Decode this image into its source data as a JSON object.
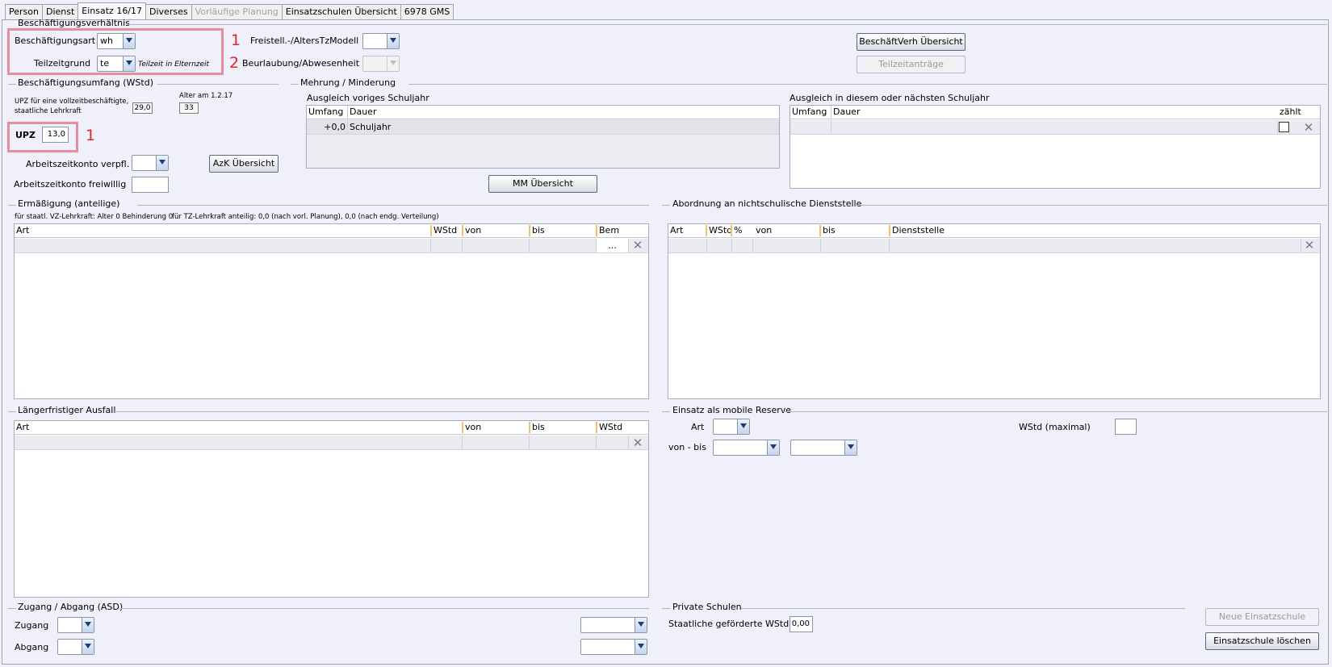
{
  "tabs": [
    "Person",
    "Dienst",
    "Einsatz 16/17",
    "Diverses",
    "Vorläufige Planung",
    "Einsatzschulen Übersicht",
    "6978 GMS"
  ],
  "beschaeftigungsverhaeltnis": {
    "title": "Beschäftigungsverhältnis",
    "beschaeftigungsart_label": "Beschäftigungsart",
    "beschaeftigungsart_value": "wh",
    "teilzeitgrund_label": "Teilzeitgrund",
    "teilzeitgrund_value": "te",
    "teilzeitgrund_desc": "Teilzeit in Elternzeit",
    "freistell_label": "Freistell.-/AltersTzModell",
    "beurlaubung_label": "Beurlaubung/Abwesenheit",
    "uebersicht_button": "BeschäftVerh Übersicht",
    "teilzeitantraege_button": "Teilzeitanträge"
  },
  "annotations": {
    "num1": "1",
    "num2": "2",
    "num3": "1"
  },
  "umfang": {
    "title": "Beschäftigungsumfang (WStd)",
    "upz_vollzeit_label_1": "UPZ für eine vollzeitbeschäftigte,",
    "upz_vollzeit_label_2": "staatliche Lehrkraft",
    "upz_vollzeit_value": "29,0",
    "alter_label": "Alter am 1.2.17",
    "alter_value": "33",
    "upz_label": "UPZ",
    "upz_value": "13,0",
    "azk_verpfl_label": "Arbeitszeitkonto verpfl.",
    "azk_freiwillig_label": "Arbeitszeitkonto freiwillig",
    "azk_button": "AzK Übersicht"
  },
  "mehrung": {
    "title": "Mehrung / Minderung",
    "voriges_title": "Ausgleich voriges Schuljahr",
    "voriges_headers": [
      "Umfang",
      "Dauer"
    ],
    "voriges_rows": [
      {
        "umfang": "+0,0",
        "dauer": "Schuljahr"
      }
    ],
    "naechstes_title": "Ausgleich in diesem oder nächsten Schuljahr",
    "naechstes_headers": [
      "Umfang",
      "Dauer",
      "zählt"
    ],
    "mm_button": "MM Übersicht"
  },
  "ermaessigung": {
    "title": "Ermäßigung (anteilige)",
    "info_left": "für staatl. VZ-Lehrkraft: Alter 0 Behinderung 0",
    "info_right": "für TZ-Lehrkraft anteilig: 0,0 (nach vorl. Planung), 0,0 (nach endg. Verteilung)",
    "headers": [
      "Art",
      "WStd",
      "von",
      "bis",
      "Bem"
    ],
    "ellipsis": "..."
  },
  "abordnung": {
    "title": "Abordnung an nichtschulische Dienststelle",
    "headers": [
      "Art",
      "WStd",
      "%",
      "von",
      "bis",
      "Dienststelle"
    ]
  },
  "ausfall": {
    "title": "Längerfristiger Ausfall",
    "headers": [
      "Art",
      "von",
      "bis",
      "WStd"
    ]
  },
  "mobile_reserve": {
    "title": "Einsatz als mobile Reserve",
    "art_label": "Art",
    "wstd_label": "WStd (maximal)",
    "von_bis_label": "von - bis"
  },
  "zugang": {
    "title": "Zugang / Abgang (ASD)",
    "zugang_label": "Zugang",
    "abgang_label": "Abgang"
  },
  "private": {
    "title": "Private Schulen",
    "wstd_label": "Staatliche geförderte WStd",
    "wstd_value": "0,00"
  },
  "footer": {
    "neue_button": "Neue Einsatzschule",
    "loeschen_button": "Einsatzschule löschen"
  }
}
